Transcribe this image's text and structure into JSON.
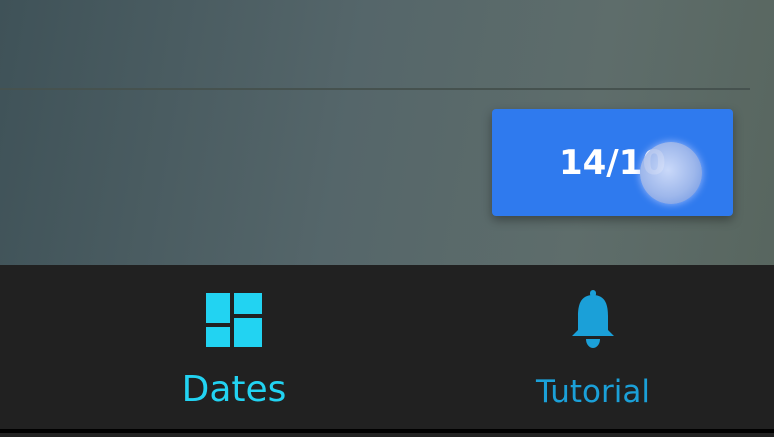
{
  "date_button": {
    "label": "14/10"
  },
  "bottom_nav": {
    "items": [
      {
        "label": "Dates",
        "icon": "dashboard-icon",
        "active": true,
        "color": "#22d3f2"
      },
      {
        "label": "Tutorial",
        "icon": "bell-icon",
        "active": false,
        "color": "#1ba0d8"
      }
    ]
  },
  "colors": {
    "button": "#2f7aee",
    "nav_background": "#212121"
  }
}
